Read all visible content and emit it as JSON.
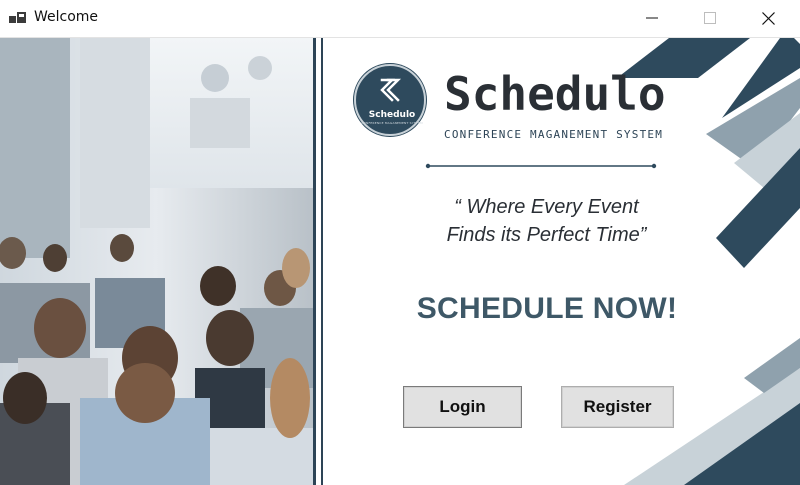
{
  "window": {
    "title": "Welcome",
    "controls": {
      "minimize": "minimize",
      "maximize": "maximize",
      "close": "close"
    }
  },
  "brand": {
    "name": "Schedulo",
    "tagline": "CONFERENCE MAGANEMENT SYSTEM",
    "logo_text": "Schedulo",
    "logo_subtext": "CONFERENCE MAGANEMENT SYSTEM"
  },
  "quote": {
    "line1": "“ Where Every Event",
    "line2": "Finds its Perfect Time”"
  },
  "cta": "SCHEDULE NOW!",
  "buttons": {
    "login": "Login",
    "register": "Register"
  },
  "colors": {
    "primary": "#2e4a5d",
    "accent": "#3e5867",
    "dark_text": "#2a2f35",
    "deco_light": "#8fa1ad",
    "deco_pale": "#c8d2d8"
  },
  "icons": {
    "app": "app-window-icon",
    "logo": "schedulo-s-logo-icon"
  }
}
